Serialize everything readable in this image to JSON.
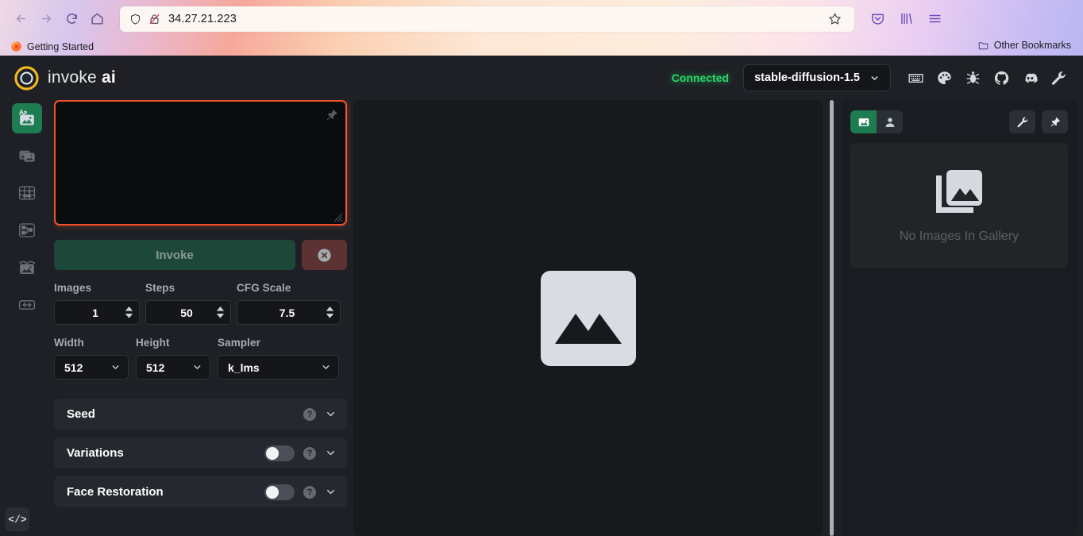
{
  "browser": {
    "url": "34.27.21.223",
    "nav": {
      "back": "back-button",
      "forward": "forward-button",
      "reload": "reload-button",
      "home": "home-button"
    },
    "shield_icon": "shield-icon",
    "lock_icon": "insecure-lock-icon",
    "star_icon": "bookmark-star-icon",
    "toolbar_right": [
      "pocket-icon",
      "library-icon",
      "menu-icon"
    ],
    "bookmarks": {
      "getting_started": "Getting Started",
      "other_bookmarks": "Other Bookmarks"
    }
  },
  "app": {
    "logo_text_light": "invoke",
    "logo_text_bold": "ai",
    "status": "Connected",
    "status_color": "#2bd86b",
    "model": "stable-diffusion-1.5",
    "header_icons": [
      {
        "name": "keyboard-shortcuts-icon"
      },
      {
        "name": "theme-palette-icon"
      },
      {
        "name": "bug-report-icon"
      },
      {
        "name": "github-icon"
      },
      {
        "name": "discord-icon"
      },
      {
        "name": "settings-wrench-icon"
      }
    ],
    "tabs": [
      {
        "name": "text-to-image",
        "icon": "text-to-image-icon",
        "active": true
      },
      {
        "name": "image-to-image",
        "icon": "image-to-image-icon",
        "active": false
      },
      {
        "name": "unified-canvas",
        "icon": "unified-canvas-icon",
        "active": false
      },
      {
        "name": "nodes",
        "icon": "nodes-icon",
        "active": false
      },
      {
        "name": "post-processing",
        "icon": "post-processing-icon",
        "active": false
      },
      {
        "name": "training",
        "icon": "training-icon",
        "active": false
      }
    ],
    "console_toggle_label": "</>",
    "accent_green": "#1d7d51",
    "prompt": {
      "value": "",
      "placeholder": "",
      "focus_border_color": "#f2522b",
      "pin_icon": "pin-icon"
    },
    "buttons": {
      "invoke": "Invoke",
      "cancel_icon": "cancel-circle-icon"
    },
    "params": {
      "images": {
        "label": "Images",
        "value": "1"
      },
      "steps": {
        "label": "Steps",
        "value": "50"
      },
      "cfg_scale": {
        "label": "CFG Scale",
        "value": "7.5"
      },
      "width": {
        "label": "Width",
        "value": "512"
      },
      "height": {
        "label": "Height",
        "value": "512"
      },
      "sampler": {
        "label": "Sampler",
        "value": "k_lms"
      }
    },
    "accordions": [
      {
        "title": "Seed",
        "has_toggle": false,
        "toggle_on": false
      },
      {
        "title": "Variations",
        "has_toggle": true,
        "toggle_on": false
      },
      {
        "title": "Face Restoration",
        "has_toggle": true,
        "toggle_on": false
      }
    ],
    "viewer": {
      "placeholder_icon": "image-placeholder-icon"
    },
    "gallery": {
      "tabs": [
        {
          "name": "generations-tab",
          "icon": "image-icon",
          "active": true
        },
        {
          "name": "uploads-tab",
          "icon": "person-icon",
          "active": false
        }
      ],
      "settings_icon": "wrench-icon",
      "pin_icon": "pin-icon",
      "empty_text": "No Images In Gallery",
      "empty_icon": "gallery-stack-icon"
    }
  }
}
